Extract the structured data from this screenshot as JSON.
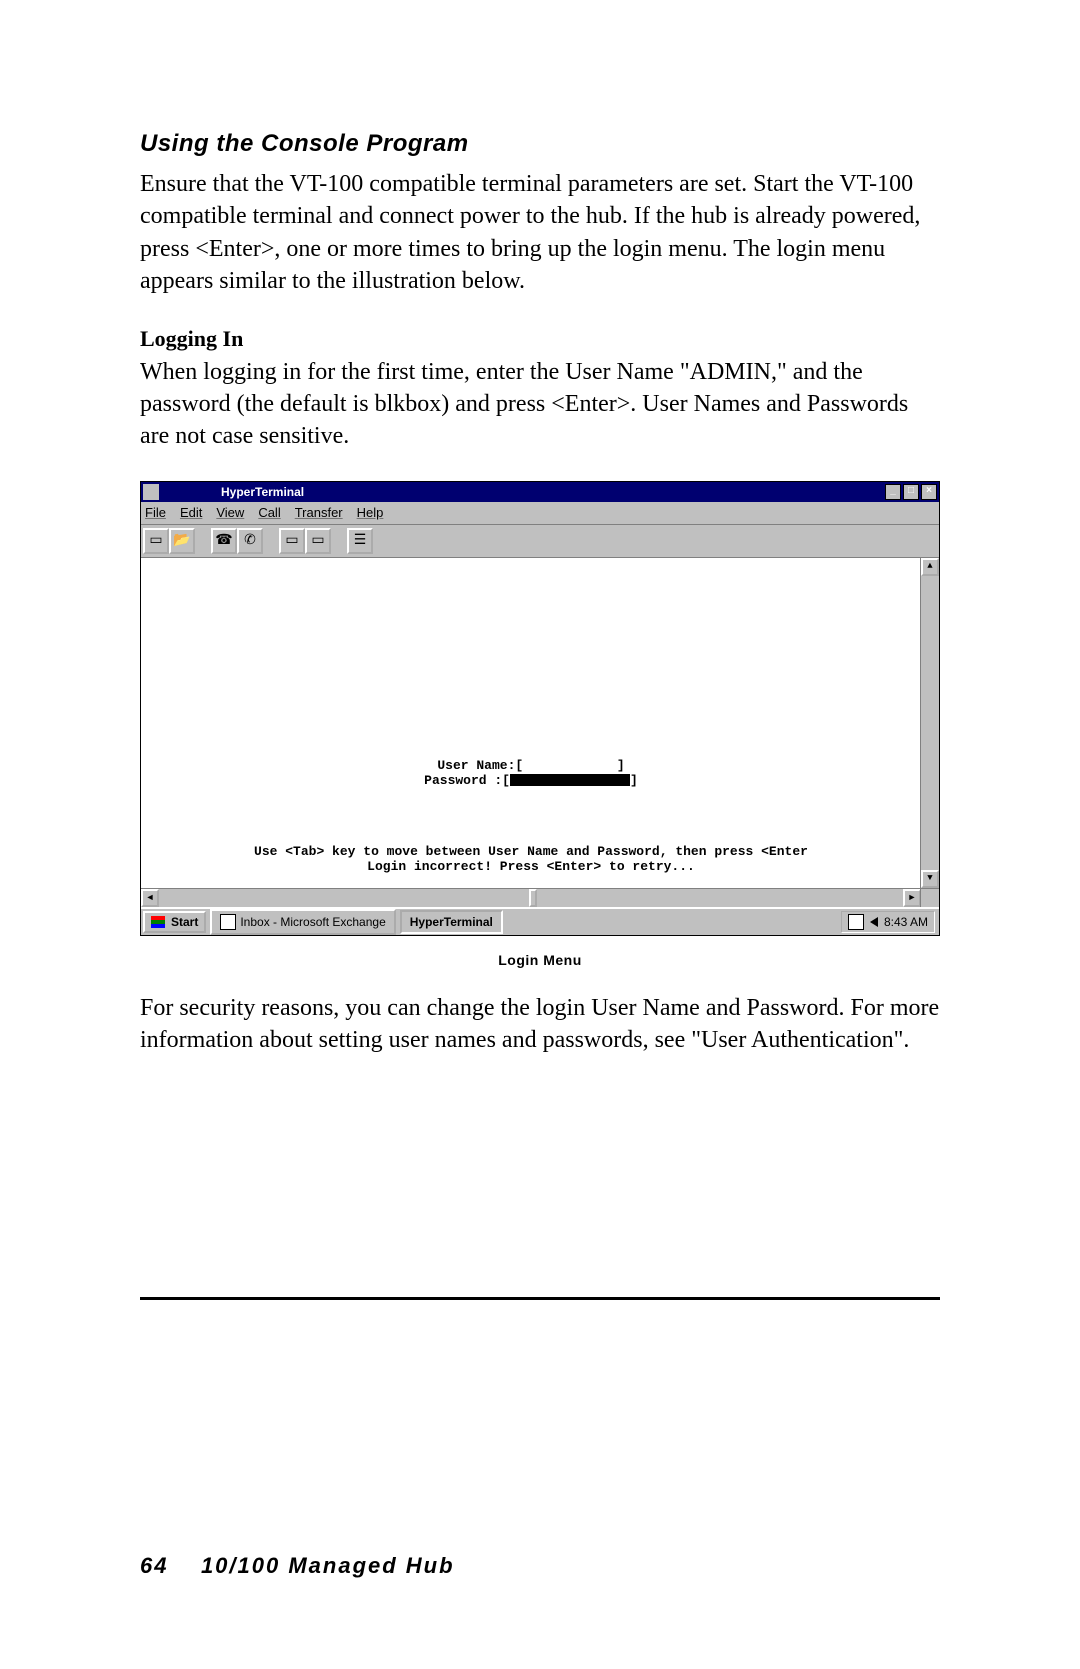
{
  "heading": "Using the Console Program",
  "para1": "Ensure that the VT-100 compatible terminal parameters are set. Start the VT-100 compatible terminal and connect power to the hub. If the hub is already powered, press <Enter>, one or more times to bring up the login menu. The login menu appears similar to the illustration below.",
  "subhead": "Logging In",
  "para2": "When logging in for the first time, enter the User Name \"ADMIN,\" and the password (the default is blkbox) and press <Enter>. User Names and Passwords are not case sensitive.",
  "screenshot": {
    "title": "HyperTerminal",
    "menu": [
      "File",
      "Edit",
      "View",
      "Call",
      "Transfer",
      "Help"
    ],
    "window_controls": {
      "min": "_",
      "max": "□",
      "close": "×"
    },
    "toolbar_icons": [
      "new-icon",
      "open-icon",
      "connect-icon",
      "disconnect-icon",
      "send-icon",
      "receive-icon",
      "properties-icon"
    ],
    "term_username_label": "User Name:[",
    "term_username_close": "]",
    "term_password_label": "Password :[",
    "term_password_close": "]",
    "help_line1": "Use <Tab> key to move between User Name and Password, then press <Enter",
    "help_line2": "Login incorrect! Press <Enter> to retry...",
    "taskbar": {
      "start": "Start",
      "task1": "Inbox - Microsoft Exchange",
      "task2": "HyperTerminal",
      "time": "8:43 AM"
    }
  },
  "caption": "Login Menu",
  "para3": "For security reasons, you can change the login User Name and Password. For more information about setting user names and passwords, see \"User Authentication\".",
  "footer_page": "64",
  "footer_title": "10/100 Managed Hub"
}
